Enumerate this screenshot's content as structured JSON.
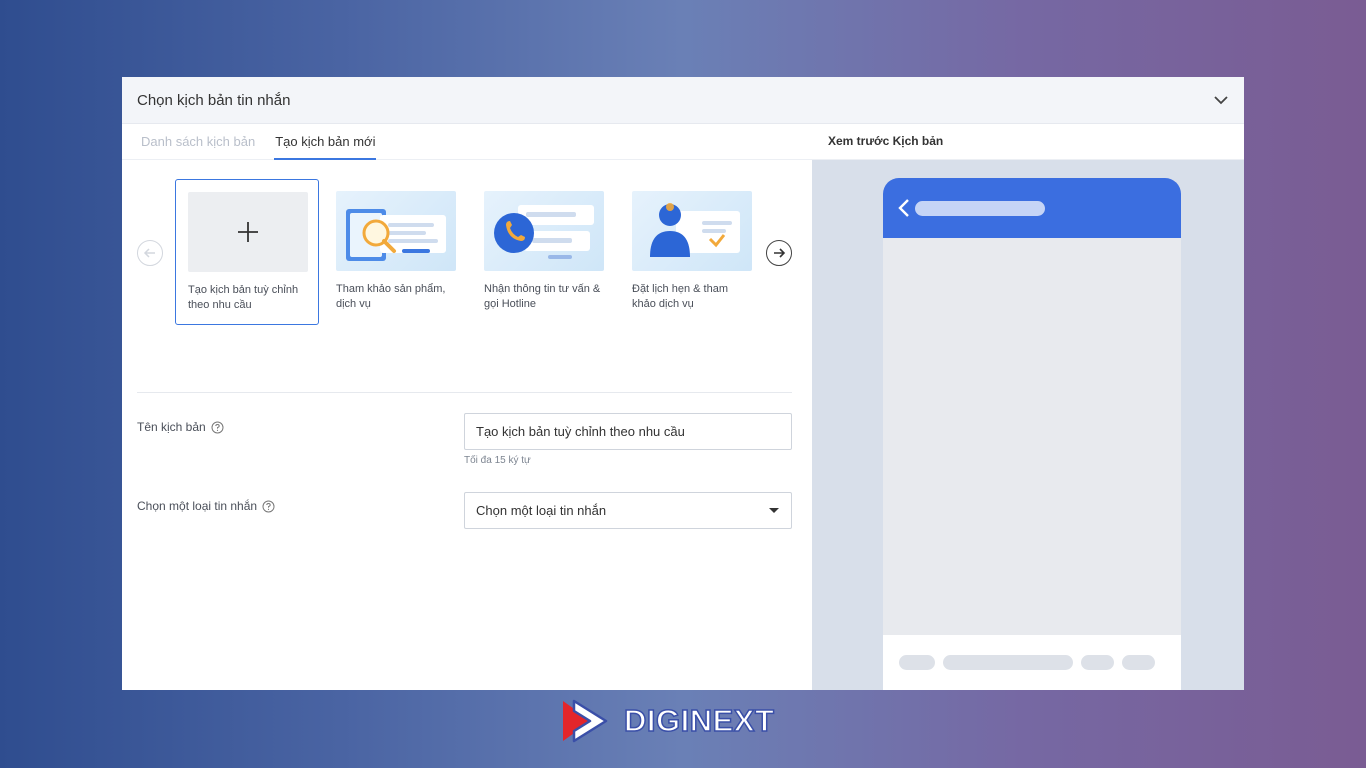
{
  "panel": {
    "title": "Chọn kịch bản tin nhắn"
  },
  "tabs": [
    {
      "label": "Danh sách kịch bản",
      "active": false
    },
    {
      "label": "Tạo kịch bản mới",
      "active": true
    }
  ],
  "templates": [
    {
      "label": "Tạo kịch bản tuỳ chỉnh theo nhu cầu",
      "selected": true,
      "icon": "plus-icon"
    },
    {
      "label": "Tham khảo sản phẩm, dịch vụ",
      "selected": false,
      "icon": "magnifier-illustration"
    },
    {
      "label": "Nhận thông tin tư vấn & gọi Hotline",
      "selected": false,
      "icon": "phone-illustration"
    },
    {
      "label": "Đặt lịch hẹn & tham khảo dịch vụ",
      "selected": false,
      "icon": "person-illustration"
    }
  ],
  "form": {
    "name_label": "Tên kịch bản",
    "name_value": "Tạo kịch bản tuỳ chỉnh theo nhu cầu",
    "name_hint": "Tối đa 15 ký tự",
    "type_label": "Chọn một loại tin nhắn",
    "type_value": "Chọn một loại tin nhắn"
  },
  "preview": {
    "title": "Xem trước Kịch bản"
  },
  "brand": {
    "name": "DIGINEXT"
  },
  "colors": {
    "accent": "#3b77e0",
    "phone_header": "#3b6ee0",
    "logo_red": "#e3262b",
    "logo_blue": "#3a4fa8"
  }
}
